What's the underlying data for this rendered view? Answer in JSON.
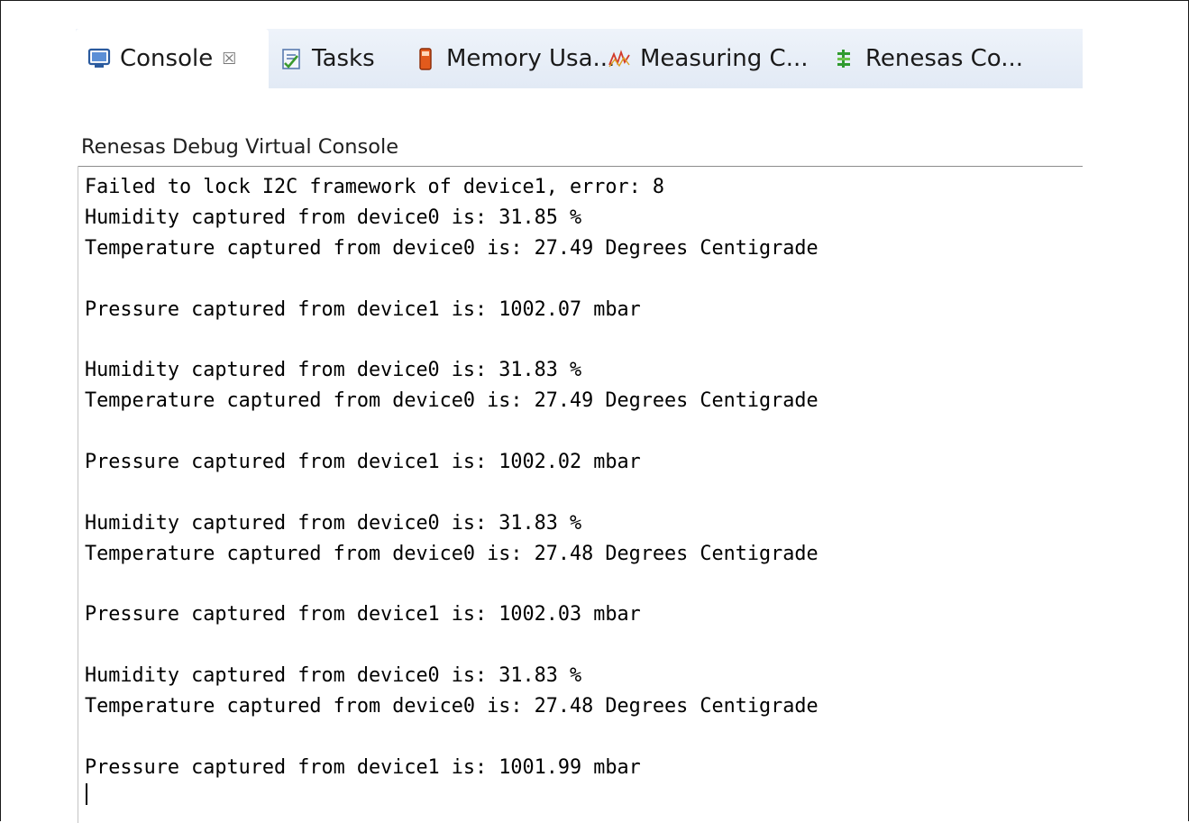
{
  "tabs": [
    {
      "label": "Console",
      "icon": "console-icon",
      "active": true,
      "closable": true,
      "close_glyph": "☒"
    },
    {
      "label": "Tasks",
      "icon": "tasks-icon",
      "active": false
    },
    {
      "label": "Memory Usa...",
      "icon": "memory-usage-icon",
      "active": false
    },
    {
      "label": "Measuring C...",
      "icon": "measuring-icon",
      "active": false
    },
    {
      "label": "Renesas Co...",
      "icon": "renesas-icon",
      "active": false
    }
  ],
  "console": {
    "title": "Renesas Debug Virtual Console",
    "lines": [
      "Failed to lock I2C framework of device1, error: 8",
      "Humidity captured from device0 is: 31.85 %",
      "Temperature captured from device0 is: 27.49 Degrees Centigrade",
      "",
      "Pressure captured from device1 is: 1002.07 mbar",
      "",
      "Humidity captured from device0 is: 31.83 %",
      "Temperature captured from device0 is: 27.49 Degrees Centigrade",
      "",
      "Pressure captured from device1 is: 1002.02 mbar",
      "",
      "Humidity captured from device0 is: 31.83 %",
      "Temperature captured from device0 is: 27.48 Degrees Centigrade",
      "",
      "Pressure captured from device1 is: 1002.03 mbar",
      "",
      "Humidity captured from device0 is: 31.83 %",
      "Temperature captured from device0 is: 27.48 Degrees Centigrade",
      "",
      "Pressure captured from device1 is: 1001.99 mbar"
    ]
  },
  "colors": {
    "tabbar_bg": "#e4ecf6",
    "active_tab_bg": "#ffffff",
    "text": "#000000"
  }
}
